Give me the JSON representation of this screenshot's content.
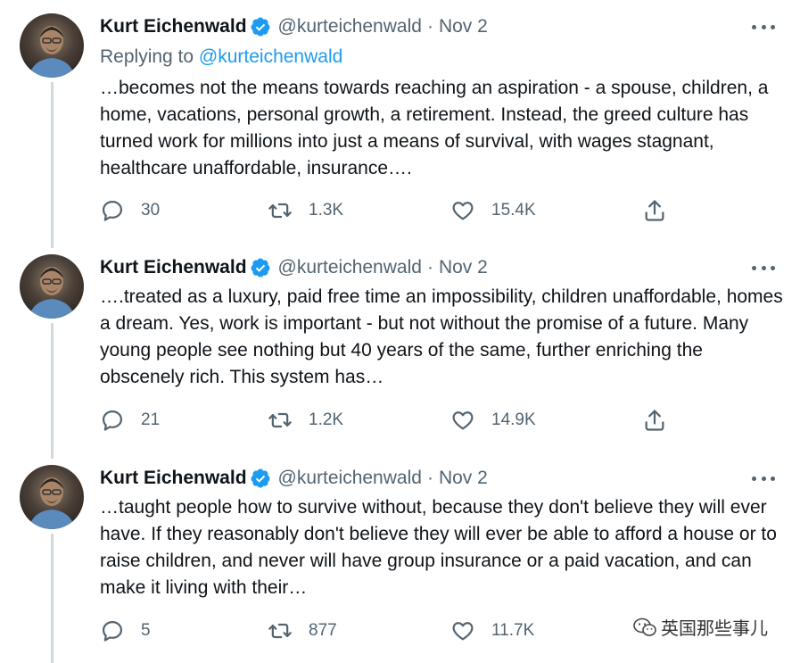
{
  "tweets": [
    {
      "name": "Kurt Eichenwald",
      "handle": "@kurteichenwald",
      "separator": "·",
      "date": "Nov 2",
      "replying_label": "Replying to",
      "replying_mention": "@kurteichenwald",
      "text": "…becomes not the means towards reaching an aspiration - a spouse, children, a home, vacations, personal growth, a retirement. Instead, the greed culture has turned work for millions into just a means of survival, with wages stagnant, healthcare unaffordable, insurance….",
      "replies": "30",
      "retweets": "1.3K",
      "likes": "15.4K"
    },
    {
      "name": "Kurt Eichenwald",
      "handle": "@kurteichenwald",
      "separator": "·",
      "date": "Nov 2",
      "text": "….treated as a luxury, paid free time an impossibility, children unaffordable, homes a dream. Yes, work is important - but not without the promise of a future. Many young people see nothing but 40 years of the same, further enriching the obscenely rich. This system has…",
      "replies": "21",
      "retweets": "1.2K",
      "likes": "14.9K"
    },
    {
      "name": "Kurt Eichenwald",
      "handle": "@kurteichenwald",
      "separator": "·",
      "date": "Nov 2",
      "text": "…taught people how to survive without, because they don't believe they will ever have. If they reasonably don't believe they will ever be able to afford a house or to raise children, and never will have group insurance or a paid vacation, and can make it living with their…",
      "replies": "5",
      "retweets": "877",
      "likes": "11.7K"
    }
  ],
  "watermark": "英国那些事儿",
  "colors": {
    "text": "#0f1419",
    "secondary": "#536471",
    "link": "#1d9bf0",
    "thread_line": "#cfd9de"
  },
  "icons": {
    "reply": "reply-icon",
    "retweet": "retweet-icon",
    "like": "heart-icon",
    "share": "share-icon",
    "verified": "verified-badge-icon",
    "more": "more-options-icon"
  }
}
